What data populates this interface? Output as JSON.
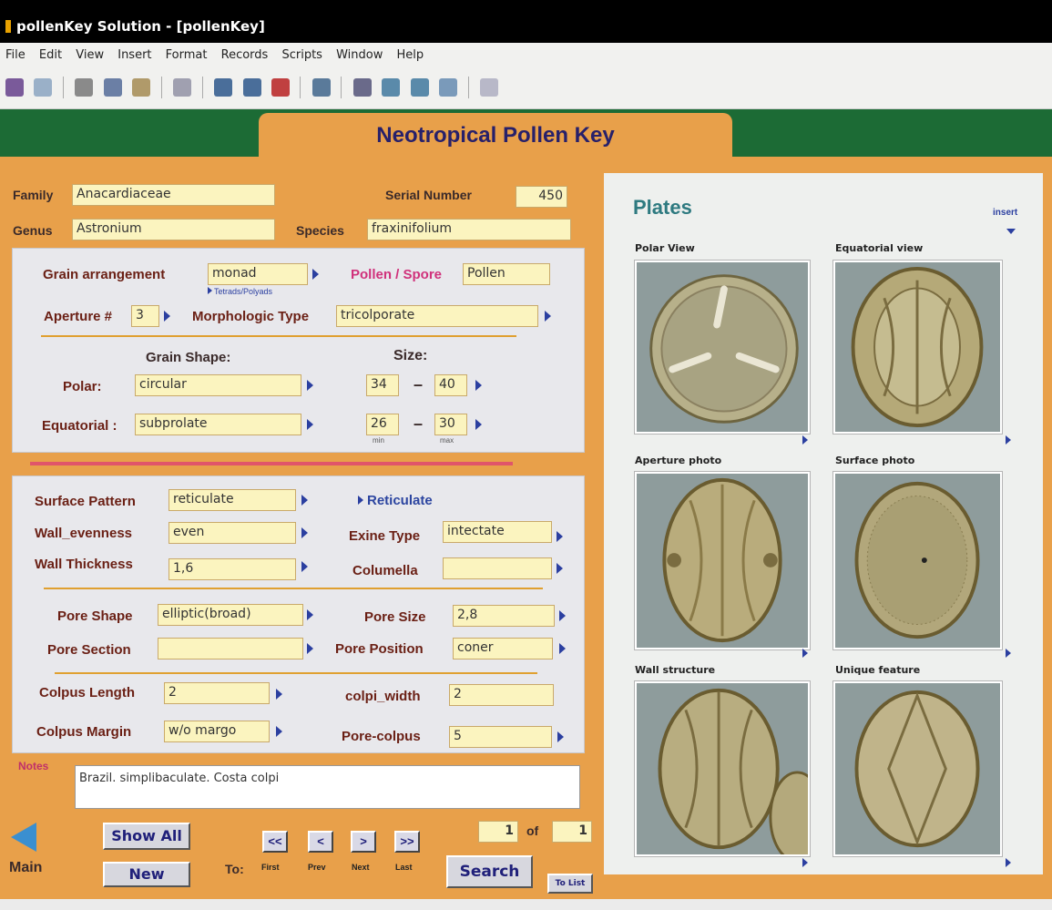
{
  "window": {
    "title": "pollenKey Solution - [pollenKey]"
  },
  "menu": [
    "File",
    "Edit",
    "View",
    "Insert",
    "Format",
    "Records",
    "Scripts",
    "Window",
    "Help"
  ],
  "header": {
    "title": "Neotropical Pollen Key"
  },
  "record": {
    "family_label": "Family",
    "family": "Anacardiaceae",
    "serial_label": "Serial Number",
    "serial": "450",
    "genus_label": "Genus",
    "genus": "Astronium",
    "species_label": "Species",
    "species": "fraxinifolium"
  },
  "grain": {
    "arrangement_label": "Grain arrangement",
    "arrangement": "monad",
    "tetrads_link": "Tetrads/Polyads",
    "pollen_spore_label": "Pollen / Spore",
    "pollen_spore": "Pollen",
    "aperture_label": "Aperture #",
    "aperture": "3",
    "morph_label": "Morphologic Type",
    "morph": "tricolporate",
    "shape_label": "Grain Shape:",
    "size_label": "Size:",
    "polar_label": "Polar:",
    "polar": "circular",
    "polar_min": "34",
    "polar_max": "40",
    "equatorial_label": "Equatorial :",
    "equatorial": "subprolate",
    "eq_min": "26",
    "eq_max": "30",
    "min_label": "min",
    "max_label": "max",
    "dash": "–"
  },
  "surface": {
    "pattern_label": "Surface Pattern",
    "pattern": "reticulate",
    "pattern_link": "Reticulate",
    "evenness_label": "Wall_evenness",
    "evenness": "even",
    "exine_label": "Exine Type",
    "exine": "intectate",
    "thickness_label": "Wall Thickness",
    "thickness": "1,6",
    "columella_label": "Columella",
    "columella": "",
    "pore_shape_label": "Pore Shape",
    "pore_shape": "elliptic(broad)",
    "pore_size_label": "Pore Size",
    "pore_size": "2,8",
    "pore_section_label": "Pore Section",
    "pore_section": "",
    "pore_position_label": "Pore Position",
    "pore_position": "coner",
    "colpus_length_label": "Colpus Length",
    "colpus_length": "2",
    "colpi_width_label": "colpi_width",
    "colpi_width": "2",
    "colpus_margin_label": "Colpus Margin",
    "colpus_margin": "w/o margo",
    "pore_colpus_label": "Pore-colpus",
    "pore_colpus": "5"
  },
  "notes": {
    "label": "Notes",
    "text": "Brazil. simplibaculate. Costa colpi"
  },
  "nav": {
    "main_label": "Main",
    "show_all": "Show All",
    "new": "New",
    "to_label": "To:",
    "first": "<<",
    "prev": "<",
    "next": ">",
    "last": ">>",
    "first_lbl": "First",
    "prev_lbl": "Prev",
    "next_lbl": "Next",
    "last_lbl": "Last",
    "current": "1",
    "of_label": "of",
    "total": "1",
    "search": "Search",
    "to_list": "To List"
  },
  "plates": {
    "title": "Plates",
    "insert": "insert",
    "items": [
      "Polar View",
      "Equatorial view",
      "Aperture photo",
      "Surface photo",
      "Wall structure",
      "Unique feature"
    ]
  },
  "colors": {
    "accent": "#e8a04a",
    "header_green": "#1c6b35",
    "title_text": "#27206a",
    "field_bg": "#fbf4bf",
    "plates_title": "#2e7a80"
  }
}
